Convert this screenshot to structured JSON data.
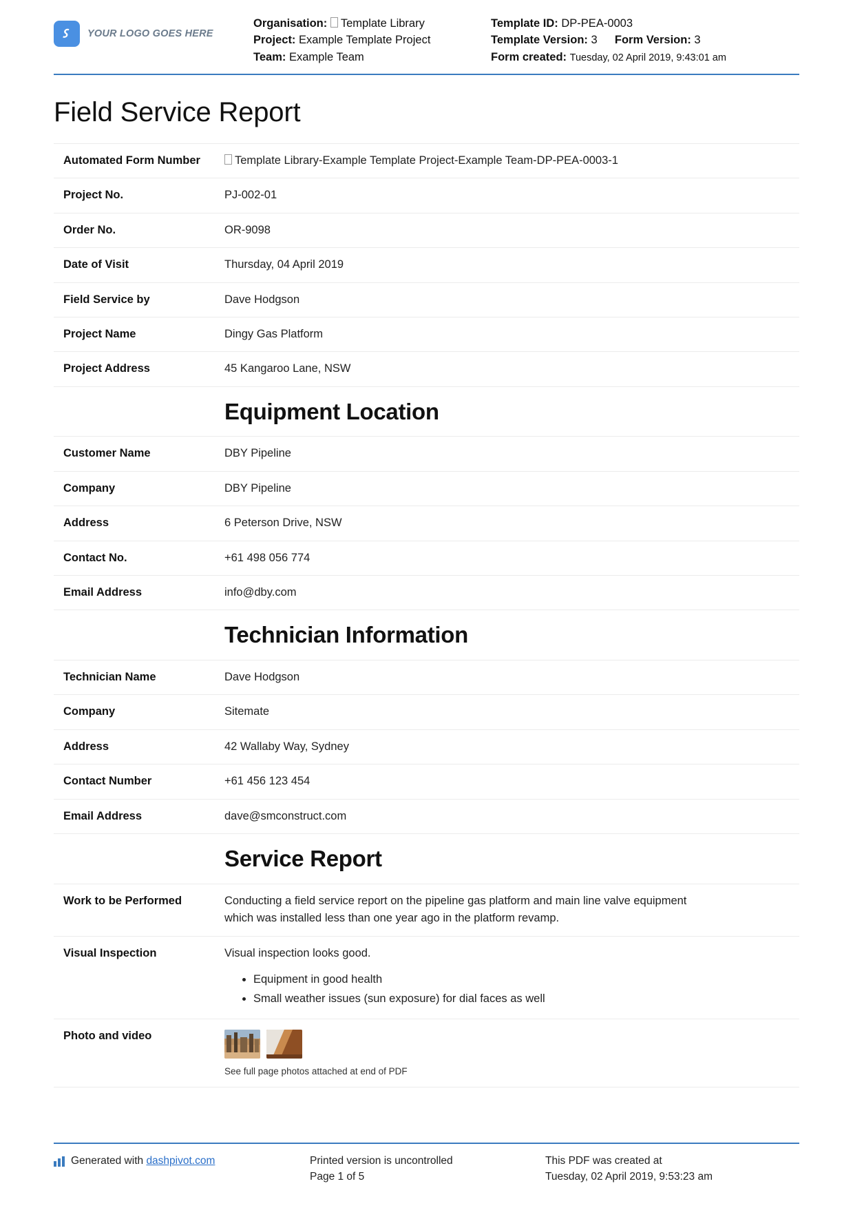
{
  "brand": {
    "accent_blue": "#3a7bbf",
    "logo_blue": "#4a90e2",
    "logo_text": "YOUR LOGO GOES HERE"
  },
  "header": {
    "organisation_label": "Organisation:",
    "organisation_value": "Template Library",
    "project_label": "Project:",
    "project_value": "Example Template Project",
    "team_label": "Team:",
    "team_value": "Example Team",
    "template_id_label": "Template ID:",
    "template_id_value": "DP-PEA-0003",
    "template_version_label": "Template Version:",
    "template_version_value": "3",
    "form_version_label": "Form Version:",
    "form_version_value": "3",
    "form_created_label": "Form created:",
    "form_created_value": "Tuesday, 02 April 2019, 9:43:01 am"
  },
  "title": "Field Service Report",
  "general": [
    {
      "label": "Automated Form Number",
      "value": "Template Library-Example Template Project-Example Team-DP-PEA-0003-1",
      "has_glyph": true
    },
    {
      "label": "Project No.",
      "value": "PJ-002-01"
    },
    {
      "label": "Order No.",
      "value": "OR-9098"
    },
    {
      "label": "Date of Visit",
      "value": "Thursday, 04 April 2019"
    },
    {
      "label": "Field Service by",
      "value": "Dave Hodgson"
    },
    {
      "label": "Project Name",
      "value": "Dingy Gas Platform"
    },
    {
      "label": "Project Address",
      "value": "45 Kangaroo Lane, NSW"
    }
  ],
  "section_equipment_location": "Equipment Location",
  "equipment_location": [
    {
      "label": "Customer Name",
      "value": "DBY Pipeline"
    },
    {
      "label": "Company",
      "value": "DBY Pipeline"
    },
    {
      "label": "Address",
      "value": "6 Peterson Drive, NSW"
    },
    {
      "label": "Contact No.",
      "value": "+61 498 056 774"
    },
    {
      "label": "Email Address",
      "value": "info@dby.com"
    }
  ],
  "section_technician_information": "Technician Information",
  "technician_information": [
    {
      "label": "Technician Name",
      "value": "Dave Hodgson"
    },
    {
      "label": "Company",
      "value": "Sitemate"
    },
    {
      "label": "Address",
      "value": "42 Wallaby Way, Sydney"
    },
    {
      "label": "Contact Number",
      "value": "+61 456 123 454"
    },
    {
      "label": "Email Address",
      "value": "dave@smconstruct.com"
    }
  ],
  "section_service_report": "Service Report",
  "service_report": {
    "work_label": "Work to be Performed",
    "work_line1": "Conducting a field service report on the pipeline gas platform and main line valve equipment",
    "work_line2": "which was installed less than one year ago in the platform revamp.",
    "visual_label": "Visual Inspection",
    "visual_intro": "Visual inspection looks good.",
    "visual_bullets": [
      "Equipment in good health",
      "Small weather issues (sun exposure) for dial faces as well"
    ],
    "photo_label": "Photo and video",
    "photo_caption": "See full page photos attached at end of PDF",
    "photos": [
      {
        "name": "site-photo-equipment"
      },
      {
        "name": "site-photo-pipe"
      }
    ]
  },
  "footer": {
    "generated_prefix": "Generated with",
    "generated_link": "dashpivot.com",
    "uncontrolled_line": "Printed version is uncontrolled",
    "page_line": "Page 1 of 5",
    "created_line1": "This PDF was created at",
    "created_line2": "Tuesday, 02 April 2019, 9:53:23 am"
  }
}
